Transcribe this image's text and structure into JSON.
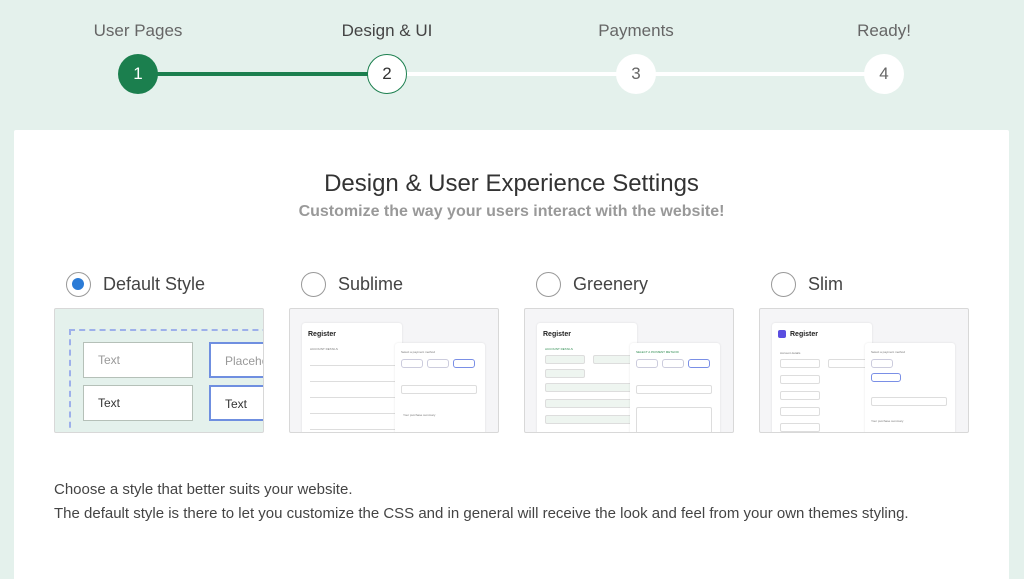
{
  "stepper": {
    "steps": [
      {
        "label": "User Pages",
        "number": "1",
        "state": "complete"
      },
      {
        "label": "Design & UI",
        "number": "2",
        "state": "current"
      },
      {
        "label": "Payments",
        "number": "3",
        "state": "pending"
      },
      {
        "label": "Ready!",
        "number": "4",
        "state": "pending"
      }
    ]
  },
  "card": {
    "title": "Design & User Experience Settings",
    "subtitle": "Customize the way your users interact with the website!"
  },
  "styles": {
    "selected": "Default Style",
    "options": [
      {
        "label": "Default Style",
        "checked": true
      },
      {
        "label": "Sublime",
        "checked": false
      },
      {
        "label": "Greenery",
        "checked": false
      },
      {
        "label": "Slim",
        "checked": false
      }
    ],
    "default_preview": {
      "field1": "Text",
      "field2": "Placeholder",
      "field3": "Text",
      "field4": "Text"
    },
    "mini_preview": {
      "register": "Register",
      "payment_method": "Select a payment method",
      "account_details": "Account details",
      "greenery_account": "ACCOUNT DETAILS",
      "greenery_payment": "SELECT A PAYMENT METHOD",
      "sublime_account": "ACCOUNT DETAILS",
      "summary": "Your purchase summary"
    }
  },
  "description": {
    "line1": "Choose a style that better suits your website.",
    "line2": "The default style is there to let you customize the CSS and in general will receive the look and feel from your own themes styling."
  },
  "colors": {
    "accent_green": "#1b7f4e",
    "radio_blue": "#2b7bd6",
    "background": "#e4f1ec"
  }
}
